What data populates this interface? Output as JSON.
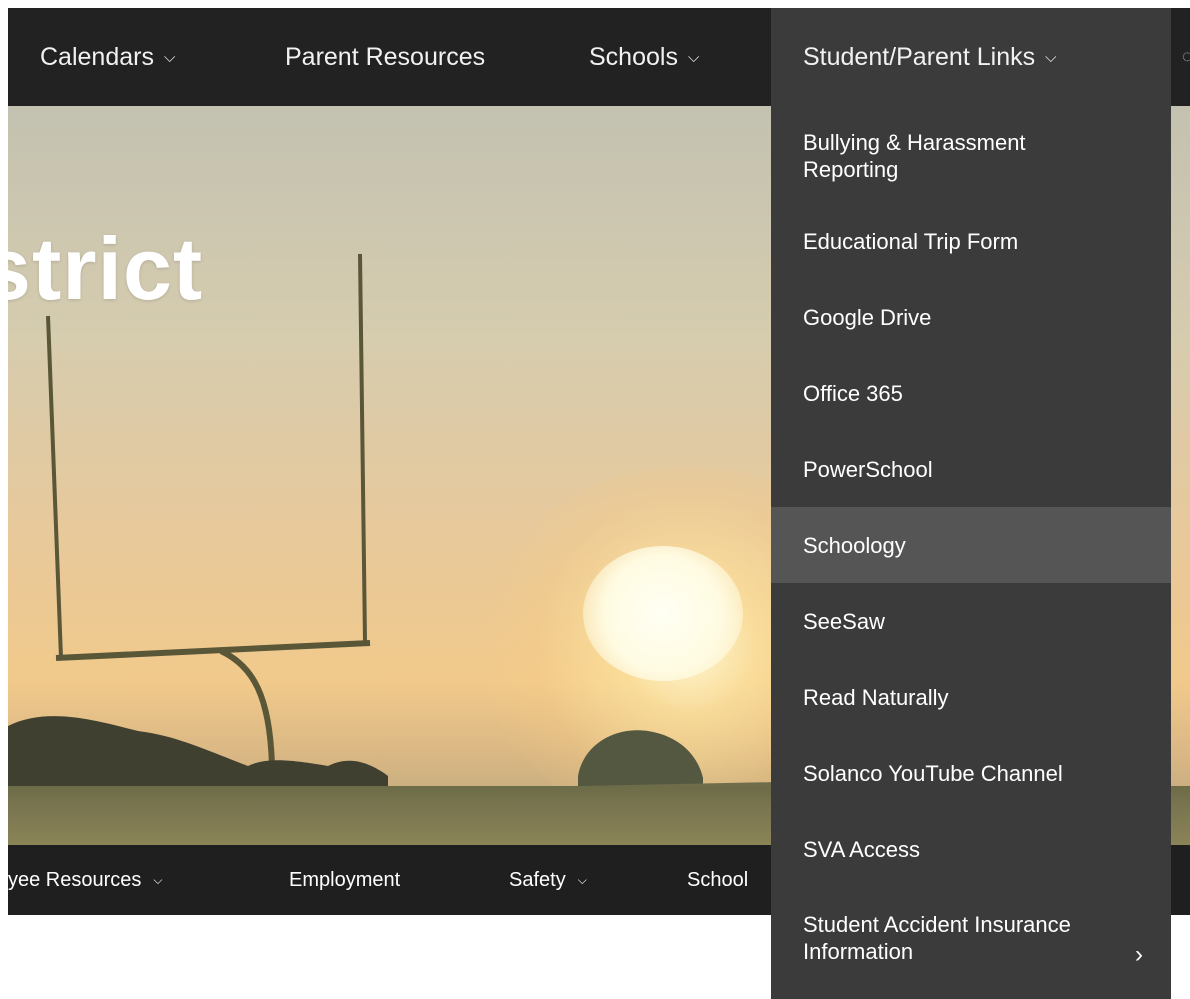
{
  "top_nav": {
    "items": [
      {
        "label": "Calendars",
        "has_dropdown": true
      },
      {
        "label": "Parent Resources",
        "has_dropdown": false
      },
      {
        "label": "Schools",
        "has_dropdown": true
      }
    ],
    "active": {
      "label": "Student/Parent Links",
      "has_dropdown": true
    }
  },
  "hero": {
    "title_fragment": "strict"
  },
  "sub_nav": {
    "items": [
      {
        "label": "yee Resources",
        "has_dropdown": true
      },
      {
        "label": "Employment",
        "has_dropdown": false
      },
      {
        "label": "Safety",
        "has_dropdown": true
      },
      {
        "label": "School",
        "has_dropdown": false
      }
    ]
  },
  "dropdown": {
    "items": [
      {
        "label": "Bullying & Harassment Reporting"
      },
      {
        "label": "Educational Trip Form"
      },
      {
        "label": "Google Drive"
      },
      {
        "label": "Office 365"
      },
      {
        "label": "PowerSchool"
      },
      {
        "label": "Schoology",
        "hovered": true
      },
      {
        "label": "SeeSaw"
      },
      {
        "label": "Read Naturally"
      },
      {
        "label": "Solanco YouTube Channel"
      },
      {
        "label": "SVA Access"
      },
      {
        "label": "Student Accident Insurance Information",
        "has_submenu": true
      }
    ]
  },
  "icons": {
    "dropdown_chevron": "chevron-down-icon",
    "submenu_arrow": "chevron-right-icon"
  },
  "colors": {
    "nav_background": "#222222",
    "dropdown_background": "#3b3b3b",
    "dropdown_hover": "#555555",
    "subnav_background": "#1f1f1f",
    "text": "#ffffff"
  }
}
